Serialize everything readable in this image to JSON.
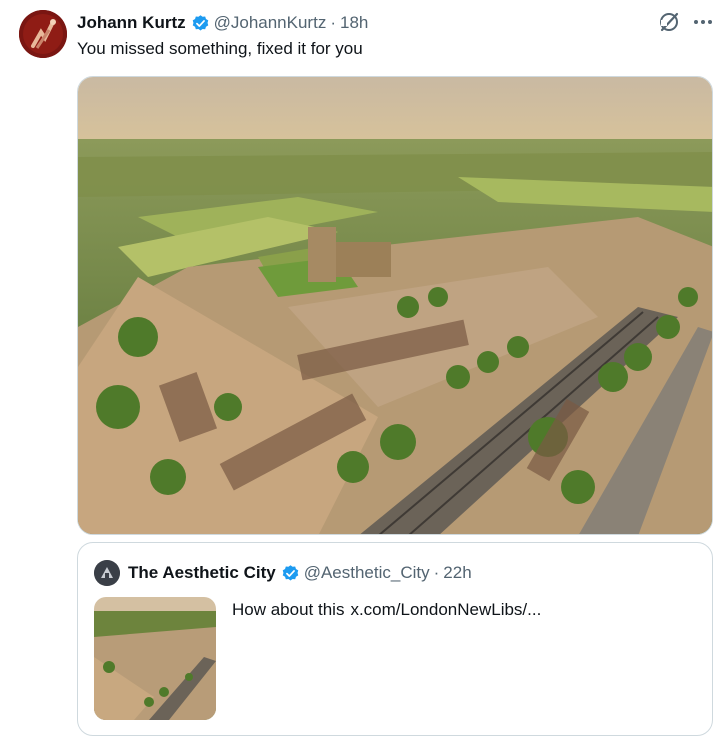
{
  "post": {
    "author_name": "Johann Kurtz",
    "author_handle": "@JohannKurtz",
    "separator": "·",
    "time": "18h",
    "text": "You missed something, fixed it for you"
  },
  "quoted_post": {
    "author_name": "The Aesthetic City",
    "author_handle": "@Aesthetic_City",
    "separator": "·",
    "time": "22h",
    "text": "How about this",
    "link": "x.com/LondonNewLibs/..."
  },
  "icons": {
    "verified": "verified-badge-icon",
    "grok": "grok-icon",
    "more": "more-options-icon"
  },
  "colors": {
    "text": "#0f1419",
    "secondary": "#536471",
    "verified": "#1d9bf0",
    "border": "#cfd9de"
  }
}
